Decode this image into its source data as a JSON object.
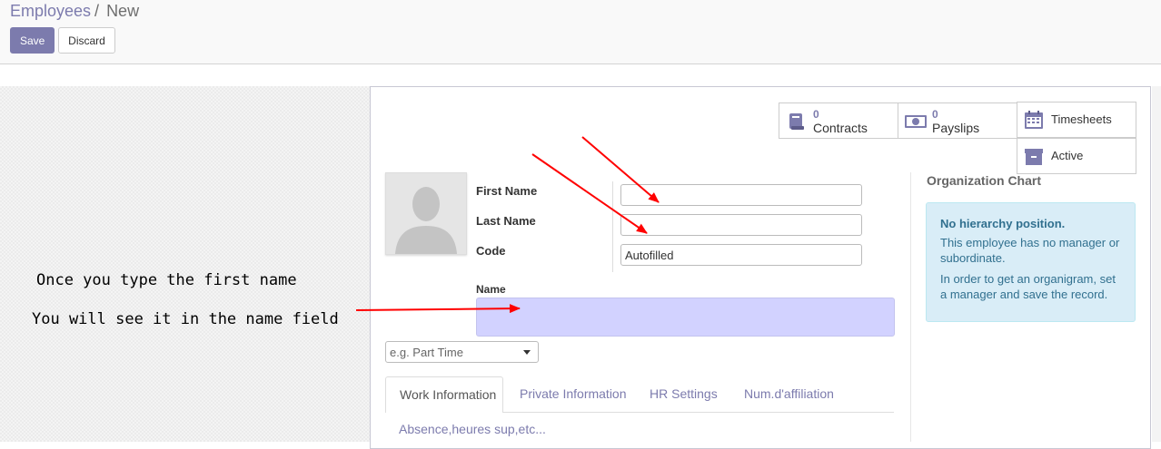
{
  "breadcrumb": {
    "parent": "Employees",
    "separator": "/",
    "current": "New"
  },
  "toolbar": {
    "save_label": "Save",
    "discard_label": "Discard"
  },
  "stats": {
    "contracts": {
      "count": "0",
      "label": "Contracts"
    },
    "payslips": {
      "count": "0",
      "label": "Payslips"
    },
    "timesheets": {
      "label": "Timesheets"
    },
    "active": {
      "label": "Active"
    }
  },
  "form": {
    "first_name_label": "First Name",
    "last_name_label": "Last Name",
    "code_label": "Code",
    "first_name_value": "",
    "last_name_value": "",
    "code_value": "Autofilled",
    "name_label": "Name",
    "name_value": "",
    "category_placeholder": "e.g. Part Time"
  },
  "tabs": [
    {
      "label": "Work Information",
      "active": true
    },
    {
      "label": "Private Information"
    },
    {
      "label": "HR Settings"
    },
    {
      "label": "Num.d'affiliation"
    },
    {
      "label": "Absence,heures sup,etc..."
    }
  ],
  "org_chart": {
    "title": "Organization Chart",
    "heading": "No hierarchy position.",
    "line1": "This employee has no manager or subordinate.",
    "line2": "In order to get an organigram, set a manager and save the record."
  },
  "annotations": {
    "line1": "Once you type the first name",
    "line2": "You will see it in the name field"
  },
  "colors": {
    "accent": "#7c7bad",
    "name_highlight": "#d2d2ff",
    "arrow": "#ff0000",
    "info_bg": "#d9edf7"
  }
}
